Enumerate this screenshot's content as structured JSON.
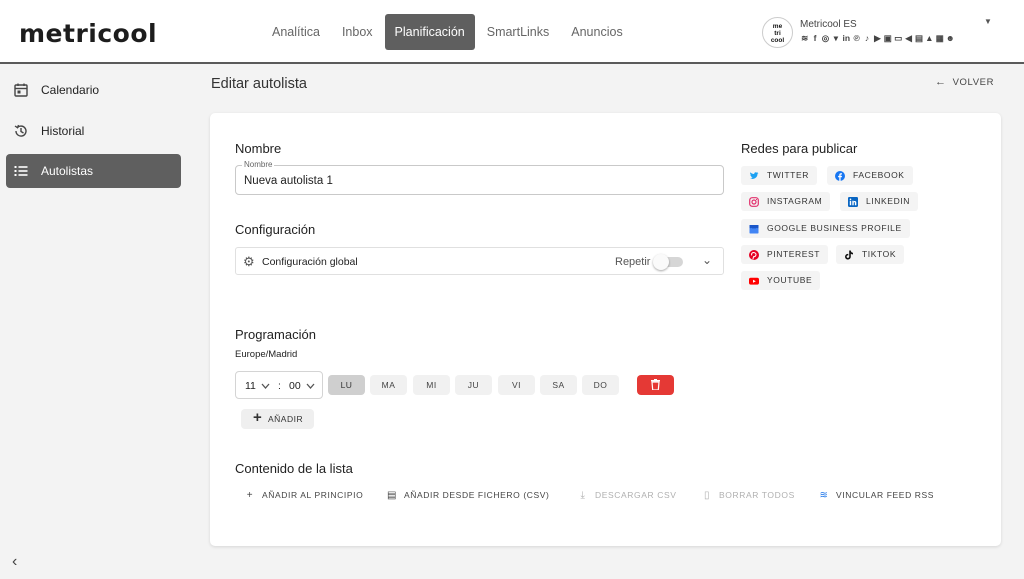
{
  "header": {
    "logo": "metricool",
    "nav": [
      "Analítica",
      "Inbox",
      "Planificación",
      "SmartLinks",
      "Anuncios"
    ],
    "active_nav": "Planificación",
    "account": {
      "logo_text": "me tri cool",
      "name": "Metricool ES",
      "network_icons": [
        "rss-icon",
        "facebook-icon",
        "instagram-icon",
        "twitter-icon",
        "linkedin-icon",
        "pinterest-icon",
        "tiktok-icon",
        "youtube-icon",
        "twitch-icon",
        "chat-icon",
        "megaphone-icon",
        "google-business-icon",
        "google-ads-icon",
        "image-icon",
        "smiley-icon"
      ]
    }
  },
  "sidebar": {
    "items": [
      {
        "label": "Calendario",
        "icon": "calendar-icon"
      },
      {
        "label": "Historial",
        "icon": "history-icon"
      },
      {
        "label": "Autolistas",
        "icon": "list-icon"
      }
    ],
    "active": "Autolistas",
    "collapse_icon": "chevron-left-icon"
  },
  "page": {
    "title": "Editar autolista",
    "back_label": "VOLVER"
  },
  "form": {
    "name_section": "Nombre",
    "name_field_label": "Nombre",
    "name_value": "Nueva autolista 1",
    "config_section": "Configuración",
    "config_label": "Configuración global",
    "repeat_label": "Repetir",
    "repeat_on": false,
    "schedule_section": "Programación",
    "timezone": "Europe/Madrid",
    "hour": "11",
    "minute": "00",
    "separator": ":",
    "days": [
      "LU",
      "MA",
      "MI",
      "JU",
      "VI",
      "SA",
      "DO"
    ],
    "active_day": "LU",
    "add_label": "AÑADIR",
    "content_section": "Contenido de la lista",
    "actions": [
      {
        "label": "AÑADIR AL PRINCIPIO",
        "icon": "plus-icon",
        "enabled": true
      },
      {
        "label": "AÑADIR DESDE FICHERO (CSV)",
        "icon": "file-icon",
        "enabled": true
      },
      {
        "label": "DESCARGAR CSV",
        "icon": "download-icon",
        "enabled": false
      },
      {
        "label": "BORRAR TODOS",
        "icon": "trash-icon",
        "enabled": false
      },
      {
        "label": "VINCULAR FEED RSS",
        "icon": "rss-icon",
        "enabled": true
      }
    ]
  },
  "networks": {
    "title": "Redes para publicar",
    "items": [
      {
        "label": "TWITTER",
        "icon": "twitter-icon",
        "color": "#1da1f2"
      },
      {
        "label": "FACEBOOK",
        "icon": "facebook-icon",
        "color": "#1877f2"
      },
      {
        "label": "INSTAGRAM",
        "icon": "instagram-icon",
        "color": "#e1306c"
      },
      {
        "label": "LINKEDIN",
        "icon": "linkedin-icon",
        "color": "#0a66c2"
      },
      {
        "label": "GOOGLE BUSINESS PROFILE",
        "icon": "google-business-icon",
        "color": "#4285f4"
      },
      {
        "label": "PINTEREST",
        "icon": "pinterest-icon",
        "color": "#e60023"
      },
      {
        "label": "TIKTOK",
        "icon": "tiktok-icon",
        "color": "#111111"
      },
      {
        "label": "YOUTUBE",
        "icon": "youtube-icon",
        "color": "#ff0000"
      }
    ]
  },
  "colors": {
    "nav_active": "#5f5f5f",
    "delete": "#e53935"
  }
}
